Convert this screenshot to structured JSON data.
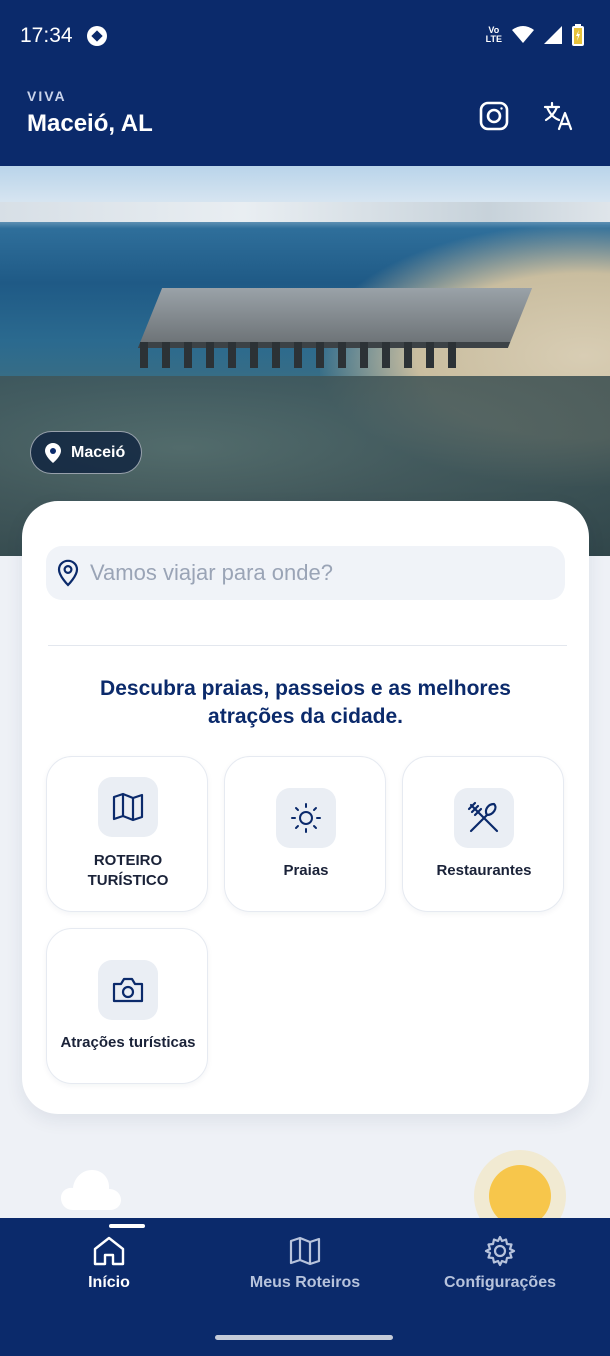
{
  "status_bar": {
    "time": "17:34",
    "volte_top": "Vo",
    "volte_bottom": "LTE",
    "icons": [
      "soccer-ball-icon",
      "wifi-icon",
      "signal-icon",
      "battery-charging-icon"
    ]
  },
  "header": {
    "kicker": "VIVA",
    "city": "Maceió, AL",
    "actions": [
      "instagram-icon",
      "translate-icon"
    ]
  },
  "hero": {
    "location_chip": "Maceió"
  },
  "search": {
    "placeholder": "Vamos viajar para onde?"
  },
  "tagline": "Descubra praias, passeios e as melhores atrações da cidade.",
  "categories": [
    {
      "label_line1": "ROTEIRO",
      "label_line2": "TURÍSTICO",
      "icon": "map-icon"
    },
    {
      "label_line1": "Praias",
      "icon": "sun-icon"
    },
    {
      "label_line1": "Restaurantes",
      "icon": "utensils-icon"
    },
    {
      "label_line1": "Atrações turísticas",
      "icon": "camera-icon"
    }
  ],
  "bottom_nav": [
    {
      "label": "Início",
      "icon": "home-icon",
      "active": true
    },
    {
      "label": "Meus Roteiros",
      "icon": "map-icon",
      "active": false
    },
    {
      "label": "Configurações",
      "icon": "gear-icon",
      "active": false
    }
  ],
  "colors": {
    "primary": "#0b2a6b",
    "surface": "#ffffff",
    "tile_icon_bg": "#eaeef4",
    "sun": "#f7c64b"
  }
}
